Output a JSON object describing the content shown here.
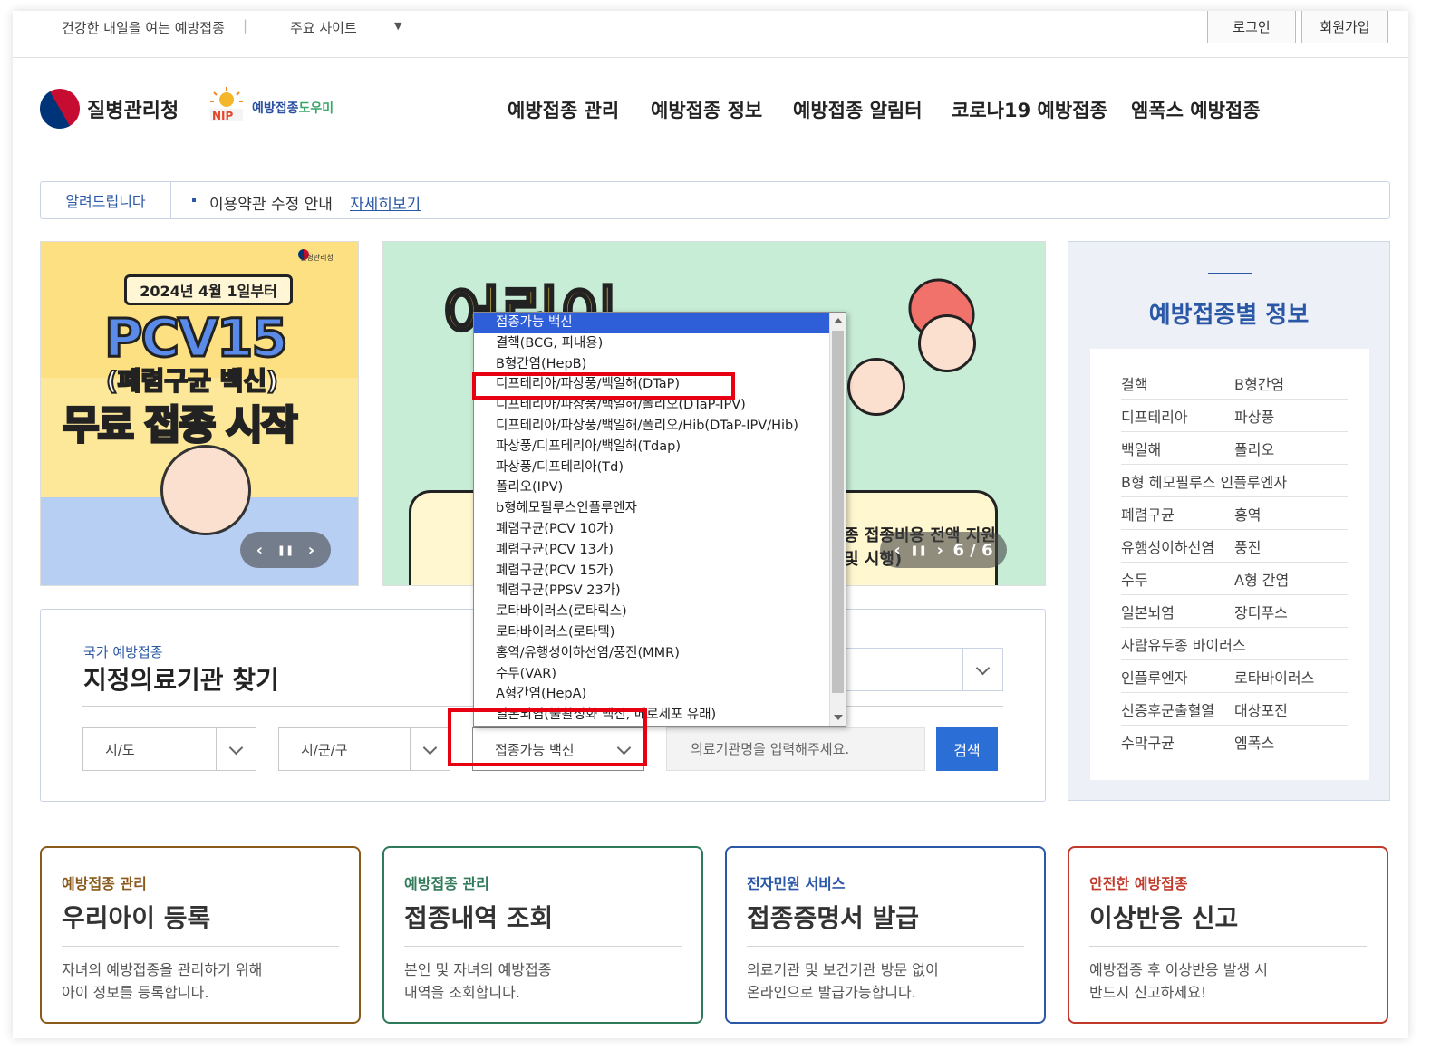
{
  "topbar": {
    "slogan": "건강한 내일을 여는 예방접종",
    "separator": "|",
    "sites_label": "주요 사이트",
    "sites_arrow": "▼",
    "login": "로그인",
    "join": "회원가입"
  },
  "header": {
    "org_name": "질병관리청",
    "nip_badge": "NIP",
    "nip_name_a": "예방접종",
    "nip_name_b": "도우미",
    "nav": [
      "예방접종 관리",
      "예방접종 정보",
      "예방접종 알림터",
      "코로나19 예방접종",
      "엠폭스 예방접종"
    ]
  },
  "notice": {
    "label": "알려드립니다",
    "text": "이용약관 수정 안내",
    "link": "자세히보기"
  },
  "banner1": {
    "kdca": "질병관리청",
    "date": "2024년 4월 1일부터",
    "title": "PCV15",
    "subtitle": "(폐렴구균 백신)",
    "main": "무료 접종 시작",
    "prev": "‹",
    "pause": "❚❚",
    "next": "›"
  },
  "banner2": {
    "title": "어린이",
    "text_line1": "종 접종비용 전액 지원",
    "text_line2": "및 시행)",
    "prev": "‹",
    "pause": "❚❚",
    "next": "›",
    "page": "6 / 6"
  },
  "vaccine_info": {
    "title": "예방접종별 정보",
    "rows": [
      [
        "결핵",
        "B형간염"
      ],
      [
        "디프테리아",
        "파상풍"
      ],
      [
        "백일해",
        "폴리오"
      ],
      [
        "B형 헤모필루스 인플루엔자"
      ],
      [
        "폐렴구균",
        "홍역"
      ],
      [
        "유행성이하선염",
        "풍진"
      ],
      [
        "수두",
        "A형 간염"
      ],
      [
        "일본뇌염",
        "장티푸스"
      ],
      [
        "사람유두종 바이러스"
      ],
      [
        "인플루엔자",
        "로타바이러스"
      ],
      [
        "신증후군출혈열",
        "대상포진"
      ],
      [
        "수막구균",
        "엠폭스"
      ]
    ]
  },
  "search": {
    "kicker": "국가 예방접종",
    "title": "지정의료기관 찾기",
    "sido": "시/도",
    "sigungu": "시/군/구",
    "vaccine": "접종가능 백신",
    "input_placeholder": "의료기관명을 입력해주세요.",
    "button": "검색"
  },
  "dropdown": {
    "items": [
      "접종가능 백신",
      "결핵(BCG, 피내용)",
      "B형간염(HepB)",
      "디프테리아/파상풍/백일해(DTaP)",
      "디프테리아/파상풍/백일해/폴리오(DTaP-IPV)",
      "디프테리아/파상풍/백일해/폴리오/Hib(DTaP-IPV/Hib)",
      "파상풍/디프테리아/백일해(Tdap)",
      "파상풍/디프테리아(Td)",
      "폴리오(IPV)",
      "b형헤모필루스인플루엔자",
      "폐렴구균(PCV 10가)",
      "폐렴구균(PCV 13가)",
      "폐렴구균(PCV 15가)",
      "폐렴구균(PPSV 23가)",
      "로타바이러스(로타릭스)",
      "로타바이러스(로타텍)",
      "홍역/유행성이하선염/풍진(MMR)",
      "수두(VAR)",
      "A형간염(HepA)",
      "일본뇌염(불활성화 백신, 베로세포 유래)"
    ]
  },
  "cards": [
    {
      "kicker": "예방접종 관리",
      "title": "우리아이 등록",
      "desc1": "자녀의 예방접종을 관리하기 위해",
      "desc2": "아이 정보를 등록합니다.",
      "color": "#8a5a1c"
    },
    {
      "kicker": "예방접종 관리",
      "title": "접종내역 조회",
      "desc1": "본인 및 자녀의 예방접종",
      "desc2": "내역을 조회합니다.",
      "color": "#2f7a5a"
    },
    {
      "kicker": "전자민원 서비스",
      "title": "접종증명서 발급",
      "desc1": "의료기관 및 보건기관 방문 없이",
      "desc2": "온라인으로 발급가능합니다.",
      "color": "#2b58a6"
    },
    {
      "kicker": "안전한 예방접종",
      "title": "이상반응 신고",
      "desc1": "예방접종 후 이상반응 발생 시",
      "desc2": "반드시 신고하세요!",
      "color": "#c0392b"
    }
  ]
}
